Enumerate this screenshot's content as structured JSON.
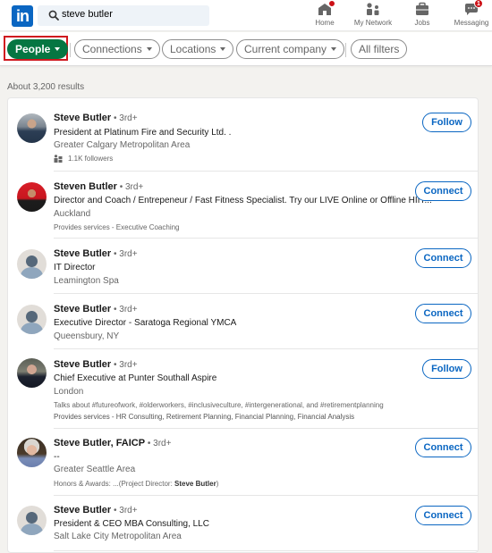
{
  "header": {
    "logo_text": "in",
    "search_value": "steve butler",
    "nav": [
      {
        "label": "Home",
        "icon": "home-icon",
        "badge": ""
      },
      {
        "label": "My Network",
        "icon": "network-icon",
        "badge": ""
      },
      {
        "label": "Jobs",
        "icon": "briefcase-icon",
        "badge": ""
      },
      {
        "label": "Messaging",
        "icon": "messaging-icon",
        "badge": "1"
      }
    ]
  },
  "filters": [
    {
      "label": "People",
      "active": true
    },
    {
      "label": "Connections",
      "active": false
    },
    {
      "label": "Locations",
      "active": false
    },
    {
      "label": "Current company",
      "active": false
    },
    {
      "label": "All filters",
      "active": false
    }
  ],
  "results_count": "About 3,200 results",
  "results": [
    {
      "name": "Steve Butler",
      "degree": " • 3rd+",
      "headline": "President at Platinum Fire and Security Ltd. .",
      "location": "Greater Calgary Metropolitan Area",
      "meta": "1.1K followers",
      "action": "Follow"
    },
    {
      "name": "Steven Butler",
      "degree": " • 3rd+",
      "headline": "Director and Coach / Entrepeneur / Fast Fitness Specialist. Try our LIVE Online or Offline HIIT...",
      "location": "Auckland",
      "meta": "Provides services - Executive Coaching",
      "action": "Connect"
    },
    {
      "name": "Steve Butler",
      "degree": " • 3rd+",
      "headline": "IT Director",
      "location": "Leamington Spa",
      "action": "Connect"
    },
    {
      "name": "Steve Butler",
      "degree": " • 3rd+",
      "headline": "Executive Director - Saratoga Regional YMCA",
      "location": "Queensbury, NY",
      "action": "Connect"
    },
    {
      "name": "Steve Butler",
      "degree": " • 3rd+",
      "headline": "Chief Executive at Punter Southall Aspire",
      "location": "London",
      "meta": "Talks about #futureofwork, #olderworkers, #inclusiveculture, #intergenerational, and #retirementplanning",
      "meta2": "Provides services - HR Consulting, Retirement Planning, Financial Planning, Financial Analysis",
      "action": "Follow"
    },
    {
      "name": "Steve Butler, FAICP",
      "degree": " • 3rd+",
      "headline": "--",
      "location": "Greater Seattle Area",
      "meta_prefix": "Honors & Awards: ...(Project Director: ",
      "meta_bold": "Steve Butler",
      "meta_suffix": ")",
      "action": "Connect"
    },
    {
      "name": "Steve Butler",
      "degree": " • 3rd+",
      "headline": "President & CEO MBA Consulting, LLC",
      "location": "Salt Lake City Metropolitan Area",
      "action": "Connect"
    }
  ]
}
